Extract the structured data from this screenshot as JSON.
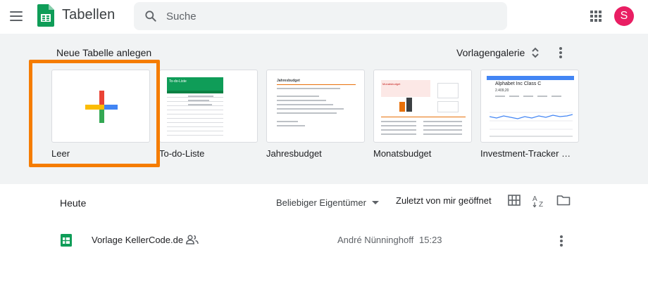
{
  "header": {
    "app_title": "Tabellen",
    "search_placeholder": "Suche",
    "avatar_initial": "S"
  },
  "templates": {
    "section_title": "Neue Tabelle anlegen",
    "gallery_label": "Vorlagengalerie",
    "items": [
      {
        "label": "Leer"
      },
      {
        "label": "To-do-Liste"
      },
      {
        "label": "Jahresbudget"
      },
      {
        "label": "Monatsbudget"
      },
      {
        "label": "Investment-Tracker a…"
      }
    ],
    "thumb_texts": {
      "todo_title": "To-do-Liste",
      "jahres_title": "Jahresbudget",
      "monats_title": "Monatsbudget",
      "invest_title": "Alphabet Inc Class C",
      "invest_value": "2.409,20"
    }
  },
  "files": {
    "section_title": "Heute",
    "owner_filter": "Beliebiger Eigentümer",
    "sort_label": "Zuletzt von mir geöffnet",
    "rows": [
      {
        "name": "Vorlage KellerCode.de",
        "owner": "André Nünninghoff",
        "time": "15:23"
      }
    ]
  },
  "colors": {
    "highlight": "#f57c00",
    "sheets_green": "#0f9d58",
    "avatar": "#e91e63",
    "section_bg": "#f1f3f4"
  }
}
